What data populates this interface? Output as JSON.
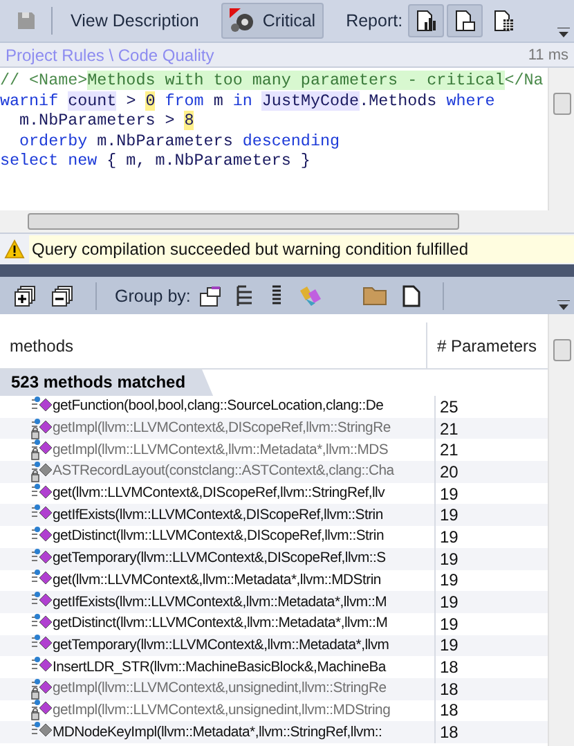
{
  "toolbar": {
    "items": [
      {
        "kind": "save"
      },
      {
        "kind": "text",
        "label": "View Description",
        "selected": false
      },
      {
        "kind": "critical",
        "label": "Critical",
        "selected": true
      },
      {
        "kind": "label",
        "label": "Report:"
      },
      {
        "kind": "report",
        "selected": true
      },
      {
        "kind": "report2",
        "selected": true
      },
      {
        "kind": "report3",
        "selected": false
      }
    ]
  },
  "breadcrumb": {
    "path": "Project Rules \\ Code Quality",
    "time": "11 ms"
  },
  "code": {
    "lines": [
      [
        {
          "kind": "comment",
          "text": "// <Name>"
        },
        {
          "kind": "comment-hl",
          "text": "Methods with too many parameters - critical"
        },
        {
          "kind": "comment",
          "text": "</Na"
        }
      ],
      [
        {
          "kind": "keyword",
          "text": "warnif "
        },
        {
          "kind": "ident-hl",
          "text": "count"
        },
        {
          "kind": "plain",
          "text": " > "
        },
        {
          "kind": "number",
          "text": "0"
        },
        {
          "kind": "keyword",
          "text": " from"
        },
        {
          "kind": "plain",
          "text": " m "
        },
        {
          "kind": "keyword",
          "text": "in "
        },
        {
          "kind": "ident-hl",
          "text": "JustMyCode"
        },
        {
          "kind": "plain",
          "text": ".Methods "
        },
        {
          "kind": "keyword",
          "text": "where"
        }
      ],
      [
        {
          "kind": "plain",
          "text": "  m.NbParameters > "
        },
        {
          "kind": "number",
          "text": "8"
        }
      ],
      [
        {
          "kind": "keyword",
          "text": "  orderby"
        },
        {
          "kind": "plain",
          "text": " m.NbParameters "
        },
        {
          "kind": "keyword",
          "text": "descending"
        }
      ],
      [
        {
          "kind": "keyword",
          "text": "select new"
        },
        {
          "kind": "plain",
          "text": " { m, m.NbParameters }"
        }
      ]
    ]
  },
  "warning": {
    "message": "Query compilation succeeded but warning condition fulfilled"
  },
  "results_toolbar": {
    "group_label": "Group by:"
  },
  "table": {
    "columns": [
      "methods",
      "# Parameters"
    ],
    "group": "523 methods matched",
    "rows": [
      {
        "kind": "method",
        "private": false,
        "name": "getFunction(bool,bool,clang::SourceLocation,clang::De",
        "count": "25"
      },
      {
        "kind": "method",
        "private": true,
        "name": "getImpl(llvm::LLVMContext&,DIScopeRef,llvm::StringRe",
        "count": "21"
      },
      {
        "kind": "method",
        "private": true,
        "name": "getImpl(llvm::LLVMContext&,llvm::Metadata*,llvm::MDS",
        "count": "21"
      },
      {
        "kind": "constructor",
        "private": true,
        "name": "ASTRecordLayout(constclang::ASTContext&,clang::Cha",
        "count": "20"
      },
      {
        "kind": "method",
        "private": false,
        "name": "get(llvm::LLVMContext&,DIScopeRef,llvm::StringRef,llv",
        "count": "19"
      },
      {
        "kind": "method",
        "private": false,
        "name": "getIfExists(llvm::LLVMContext&,DIScopeRef,llvm::Strin",
        "count": "19"
      },
      {
        "kind": "method",
        "private": false,
        "name": "getDistinct(llvm::LLVMContext&,DIScopeRef,llvm::Strin",
        "count": "19"
      },
      {
        "kind": "method",
        "private": false,
        "name": "getTemporary(llvm::LLVMContext&,DIScopeRef,llvm::S",
        "count": "19"
      },
      {
        "kind": "method",
        "private": false,
        "name": "get(llvm::LLVMContext&,llvm::Metadata*,llvm::MDStrin",
        "count": "19"
      },
      {
        "kind": "method",
        "private": false,
        "name": "getIfExists(llvm::LLVMContext&,llvm::Metadata*,llvm::M",
        "count": "19"
      },
      {
        "kind": "method",
        "private": false,
        "name": "getDistinct(llvm::LLVMContext&,llvm::Metadata*,llvm::M",
        "count": "19"
      },
      {
        "kind": "method",
        "private": false,
        "name": "getTemporary(llvm::LLVMContext&,llvm::Metadata*,llvm",
        "count": "19"
      },
      {
        "kind": "method",
        "private": false,
        "name": "InsertLDR_STR(llvm::MachineBasicBlock&,MachineBa",
        "count": "18"
      },
      {
        "kind": "method",
        "private": true,
        "name": "getImpl(llvm::LLVMContext&,unsignedint,llvm::StringRe",
        "count": "18"
      },
      {
        "kind": "method",
        "private": true,
        "name": "getImpl(llvm::LLVMContext&,unsignedint,llvm::MDString",
        "count": "18"
      },
      {
        "kind": "constructor",
        "private": false,
        "name": "MDNodeKeyImpl(llvm::Metadata*,llvm::StringRef,llvm::",
        "count": "18"
      }
    ]
  }
}
